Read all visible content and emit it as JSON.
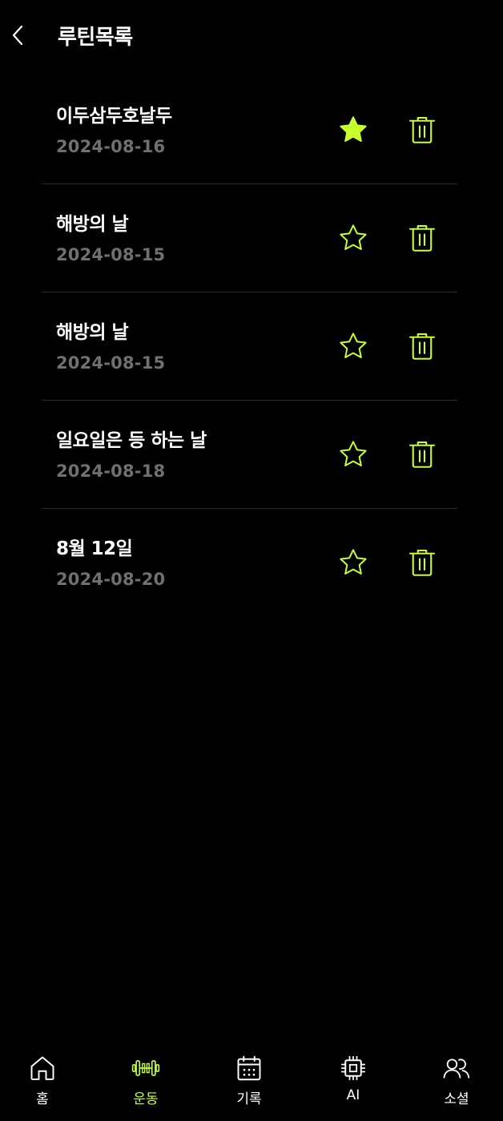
{
  "header": {
    "title": "루틴목록"
  },
  "colors": {
    "accent": "#c8ff2e",
    "background": "#000000",
    "date_text": "#707070",
    "divider": "#2a2a2a"
  },
  "routines": [
    {
      "name": "이두삼두호날두",
      "date": "2024-08-16",
      "favorite": true
    },
    {
      "name": "해방의 날",
      "date": "2024-08-15",
      "favorite": false
    },
    {
      "name": "해방의 날",
      "date": "2024-08-15",
      "favorite": false
    },
    {
      "name": "일요일은 등 하는 날",
      "date": "2024-08-18",
      "favorite": false
    },
    {
      "name": "8월 12일",
      "date": "2024-08-20",
      "favorite": false
    }
  ],
  "nav": {
    "items": [
      {
        "label": "홈",
        "icon": "home-icon",
        "active": false
      },
      {
        "label": "운동",
        "icon": "dumbbell-icon",
        "active": true
      },
      {
        "label": "기록",
        "icon": "calendar-icon",
        "active": false
      },
      {
        "label": "AI",
        "icon": "chip-icon",
        "active": false
      },
      {
        "label": "소셜",
        "icon": "users-icon",
        "active": false
      }
    ]
  }
}
